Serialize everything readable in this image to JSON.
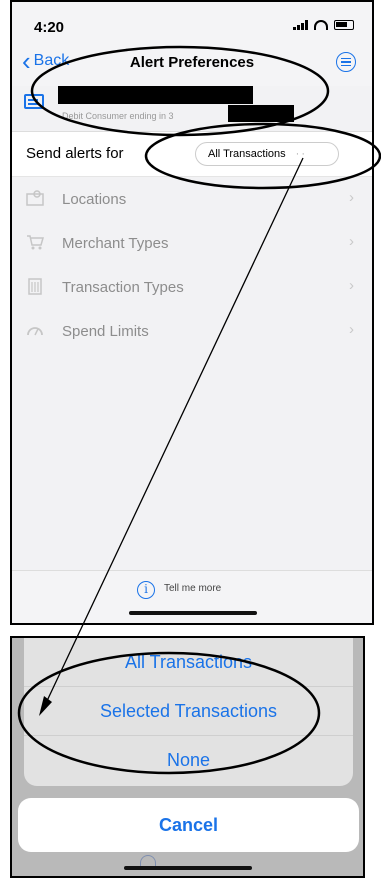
{
  "status_bar": {
    "time": "4:20"
  },
  "nav": {
    "back_label": "Back",
    "title": "Alert Preferences"
  },
  "account": {
    "subtitle": "Debit Consumer ending in 3"
  },
  "send_alerts": {
    "label": "Send alerts for",
    "value": "All Transactions",
    "more_indicator": "··"
  },
  "filters": [
    {
      "label": "Locations",
      "icon": "map-icon"
    },
    {
      "label": "Merchant Types",
      "icon": "cart-icon"
    },
    {
      "label": "Transaction Types",
      "icon": "building-icon"
    },
    {
      "label": "Spend Limits",
      "icon": "gauge-icon"
    }
  ],
  "footer": {
    "info_label": "Tell me more"
  },
  "action_sheet": {
    "options": [
      "All Transactions",
      "Selected Transactions",
      "None"
    ],
    "cancel_label": "Cancel"
  },
  "colors": {
    "accent": "#1a73e8",
    "annotation": "#000000"
  }
}
